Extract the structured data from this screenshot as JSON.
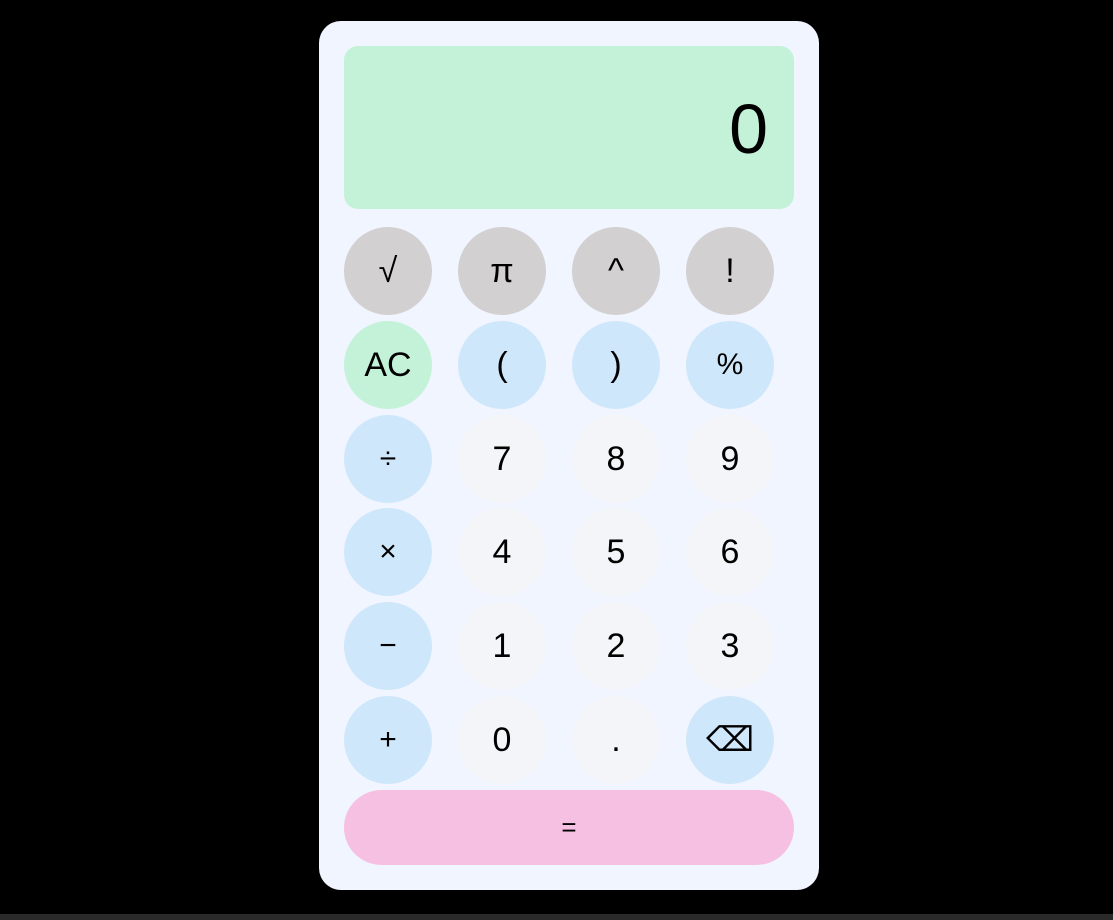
{
  "display": {
    "value": "0"
  },
  "keys": {
    "sqrt": "√",
    "pi": "π",
    "power": "^",
    "factorial": "!",
    "clear": "AC",
    "open_paren": "(",
    "close_paren": ")",
    "percent": "%",
    "divide": "÷",
    "seven": "7",
    "eight": "8",
    "nine": "9",
    "multiply": "×",
    "four": "4",
    "five": "5",
    "six": "6",
    "subtract": "−",
    "one": "1",
    "two": "2",
    "three": "3",
    "add": "+",
    "zero": "0",
    "decimal": ".",
    "backspace": "⌫",
    "equals": "="
  },
  "colors": {
    "background": "#000000",
    "panel": "#f1f5ff",
    "display": "#c4f2d8",
    "scientific_key": "#d3d0d1",
    "clear_key": "#c4f2d8",
    "operator_key": "#cfe7fb",
    "number_key": "#f4f5f8",
    "equals_key": "#f5c0e2"
  },
  "icons": {
    "backspace": "backspace-icon"
  }
}
